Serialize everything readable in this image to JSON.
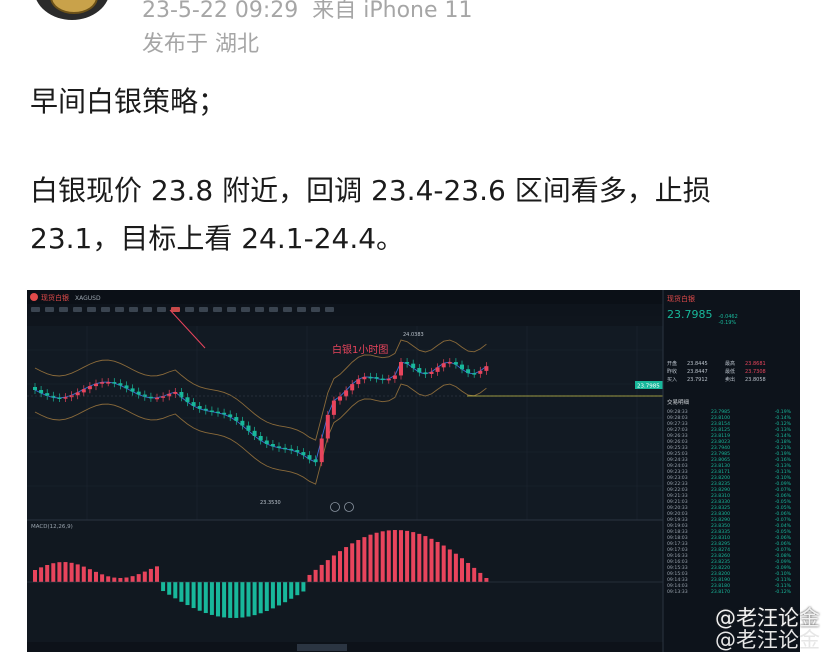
{
  "post": {
    "timestamp": "23-5-22 09:29",
    "source": "来自 iPhone 11",
    "location": "发布于 湖北",
    "paragraph1": "早间白银策略；",
    "paragraph2": "白银现价 23.8 附近，回调 23.4-23.6 区间看多，止损",
    "paragraph3": "23.1，目标上看 24.1-24.4。"
  },
  "screenshot": {
    "symbol": "现货白银",
    "ticker": "XAGUSD",
    "chart_annotation": "白银1小时图",
    "price_tag": "23.7985",
    "low_label": "23.3530",
    "high_label": "24.0383",
    "macd_label": "MACD(12,26,9)",
    "right_panel": {
      "title": "现货白银",
      "price": "23.7985",
      "change": "-0.0462",
      "change_pct": "-0.19%",
      "quote_rows": [
        [
          "开盘",
          "23.8445",
          "最高",
          "23.8681"
        ],
        [
          "昨收",
          "23.8447",
          "最低",
          "23.7308"
        ],
        [
          "买入",
          "23.7912",
          "卖出",
          "23.8058"
        ]
      ],
      "ticks_header": "交易明细",
      "ticks": [
        [
          "09:28:33",
          "23.7985",
          "-0.19%"
        ],
        [
          "09:28:03",
          "23.8100",
          "-0.14%"
        ],
        [
          "09:27:33",
          "23.8154",
          "-0.12%"
        ],
        [
          "09:27:03",
          "23.8125",
          "-0.13%"
        ],
        [
          "09:26:33",
          "23.8119",
          "-0.14%"
        ],
        [
          "09:26:03",
          "23.8023",
          "-0.18%"
        ],
        [
          "09:25:33",
          "23.7940",
          "-0.21%"
        ],
        [
          "09:25:03",
          "23.7985",
          "-0.19%"
        ],
        [
          "09:24:33",
          "23.8065",
          "-0.16%"
        ],
        [
          "09:24:03",
          "23.8130",
          "-0.13%"
        ],
        [
          "09:23:33",
          "23.8171",
          "-0.11%"
        ],
        [
          "09:23:03",
          "23.8200",
          "-0.10%"
        ],
        [
          "09:22:33",
          "23.8235",
          "-0.09%"
        ],
        [
          "09:22:03",
          "23.8290",
          "-0.07%"
        ],
        [
          "09:21:33",
          "23.8310",
          "-0.06%"
        ],
        [
          "09:21:03",
          "23.8330",
          "-0.05%"
        ],
        [
          "09:20:33",
          "23.8325",
          "-0.05%"
        ],
        [
          "09:20:03",
          "23.8300",
          "-0.06%"
        ],
        [
          "09:19:33",
          "23.8290",
          "-0.07%"
        ],
        [
          "09:19:03",
          "23.8350",
          "-0.04%"
        ],
        [
          "09:18:33",
          "23.8335",
          "-0.05%"
        ],
        [
          "09:18:03",
          "23.8310",
          "-0.06%"
        ],
        [
          "09:17:33",
          "23.8295",
          "-0.06%"
        ],
        [
          "09:17:03",
          "23.8274",
          "-0.07%"
        ],
        [
          "09:16:33",
          "23.8260",
          "-0.08%"
        ],
        [
          "09:16:03",
          "23.8235",
          "-0.09%"
        ],
        [
          "09:15:33",
          "23.8220",
          "-0.09%"
        ],
        [
          "09:15:03",
          "23.8200",
          "-0.10%"
        ],
        [
          "09:14:33",
          "23.8190",
          "-0.11%"
        ],
        [
          "09:14:03",
          "23.8180",
          "-0.11%"
        ],
        [
          "09:13:33",
          "23.8170",
          "-0.12%"
        ]
      ]
    }
  },
  "watermark": {
    "line1": "@老汪论金",
    "line2": "@老汪论金"
  },
  "colors": {
    "up": "#e8445c",
    "down": "#18b89b",
    "panel_bg": "#111820"
  }
}
